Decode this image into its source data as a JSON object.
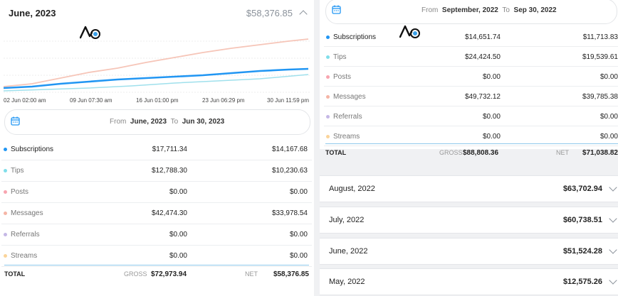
{
  "left": {
    "month": "June, 2023",
    "total": "$58,376.85",
    "chart_labels": [
      "02 Jun 02:00 am",
      "09 Jun 07:30 am",
      "16 Jun 01:00 pm",
      "23 Jun 06:29 pm",
      "30 Jun 11:59 pm"
    ],
    "range": {
      "from_word": "From",
      "from": "June, 2023",
      "to_word": "To",
      "to": "Jun 30, 2023"
    },
    "rows": [
      {
        "label": "Subscriptions",
        "gross": "$17,711.34",
        "net": "$14,167.68",
        "color": "#2196f3"
      },
      {
        "label": "Tips",
        "gross": "$12,788.30",
        "net": "$10,230.63",
        "color": "#80deea"
      },
      {
        "label": "Posts",
        "gross": "$0.00",
        "net": "$0.00",
        "color": "#f8a5b0"
      },
      {
        "label": "Messages",
        "gross": "$42,474.30",
        "net": "$33,978.54",
        "color": "#f5b5a6"
      },
      {
        "label": "Referrals",
        "gross": "$0.00",
        "net": "$0.00",
        "color": "#c5b8e6"
      },
      {
        "label": "Streams",
        "gross": "$0.00",
        "net": "$0.00",
        "color": "#fbd49a"
      }
    ],
    "total_row": {
      "label": "TOTAL",
      "gross_tag": "GROSS",
      "gross": "$72,973.94",
      "net_tag": "NET",
      "net": "$58,376.85"
    }
  },
  "right": {
    "range": {
      "from_word": "From",
      "from": "September, 2022",
      "to_word": "To",
      "to": "Sep 30, 2022"
    },
    "rows": [
      {
        "label": "Subscriptions",
        "gross": "$14,651.74",
        "net": "$11,713.83",
        "color": "#2196f3"
      },
      {
        "label": "Tips",
        "gross": "$24,424.50",
        "net": "$19,539.61",
        "color": "#80deea"
      },
      {
        "label": "Posts",
        "gross": "$0.00",
        "net": "$0.00",
        "color": "#f8a5b0"
      },
      {
        "label": "Messages",
        "gross": "$49,732.12",
        "net": "$39,785.38",
        "color": "#f5b5a6"
      },
      {
        "label": "Referrals",
        "gross": "$0.00",
        "net": "$0.00",
        "color": "#c5b8e6"
      },
      {
        "label": "Streams",
        "gross": "$0.00",
        "net": "$0.00",
        "color": "#fbd49a"
      }
    ],
    "total_row": {
      "label": "TOTAL",
      "gross_tag": "GROSS",
      "gross": "$88,808.36",
      "net_tag": "NET",
      "net": "$71,038.82"
    },
    "months": [
      {
        "name": "August, 2022",
        "total": "$63,702.94"
      },
      {
        "name": "July, 2022",
        "total": "$60,738.51"
      },
      {
        "name": "June, 2022",
        "total": "$51,524.28"
      },
      {
        "name": "May, 2022",
        "total": "$12,575.26"
      }
    ]
  }
}
